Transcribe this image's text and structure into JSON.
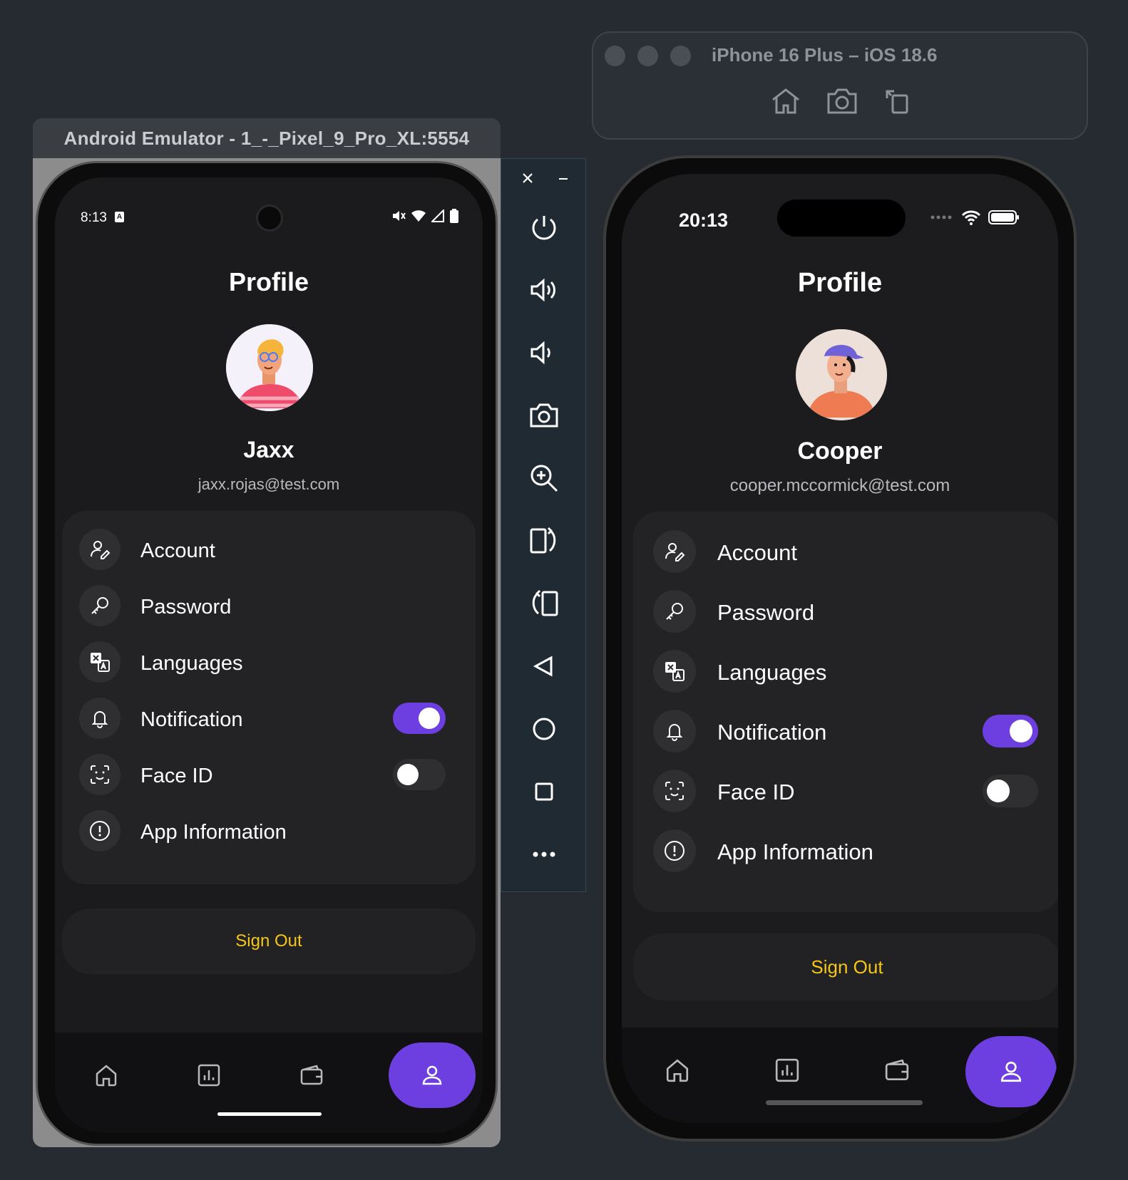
{
  "android": {
    "window_title": "Android Emulator - 1_-_Pixel_9_Pro_XL:5554",
    "status_time": "8:13",
    "status_time_badge": "A",
    "page_title": "Profile",
    "user_name": "Jaxx",
    "user_email": "jaxx.rojas@test.com",
    "menu": [
      {
        "label": "Account",
        "icon": "user-edit-icon"
      },
      {
        "label": "Password",
        "icon": "key-icon"
      },
      {
        "label": "Languages",
        "icon": "translate-icon"
      },
      {
        "label": "Notification",
        "icon": "bell-icon",
        "toggle": true
      },
      {
        "label": "Face ID",
        "icon": "face-id-icon",
        "toggle": false
      },
      {
        "label": "App Information",
        "icon": "info-icon"
      }
    ],
    "sign_out": "Sign Out",
    "nav": [
      "home-icon",
      "chart-icon",
      "wallet-icon",
      "profile-icon"
    ],
    "nav_active": "profile-icon"
  },
  "ios": {
    "window_title": "iPhone 16 Plus – iOS 18.6",
    "status_time": "20:13",
    "page_title": "Profile",
    "user_name": "Cooper",
    "user_email": "cooper.mccormick@test.com",
    "menu": [
      {
        "label": "Account",
        "icon": "user-edit-icon"
      },
      {
        "label": "Password",
        "icon": "key-icon"
      },
      {
        "label": "Languages",
        "icon": "translate-icon"
      },
      {
        "label": "Notification",
        "icon": "bell-icon",
        "toggle": true
      },
      {
        "label": "Face ID",
        "icon": "face-id-icon",
        "toggle": false
      },
      {
        "label": "App Information",
        "icon": "info-icon"
      }
    ],
    "sign_out": "Sign Out",
    "nav": [
      "home-icon",
      "chart-icon",
      "wallet-icon",
      "profile-icon"
    ],
    "nav_active": "profile-icon"
  },
  "colors": {
    "accent": "#6e3fe0",
    "sign_out": "#f5c518",
    "background": "#1b1b1d",
    "card": "#232325"
  }
}
